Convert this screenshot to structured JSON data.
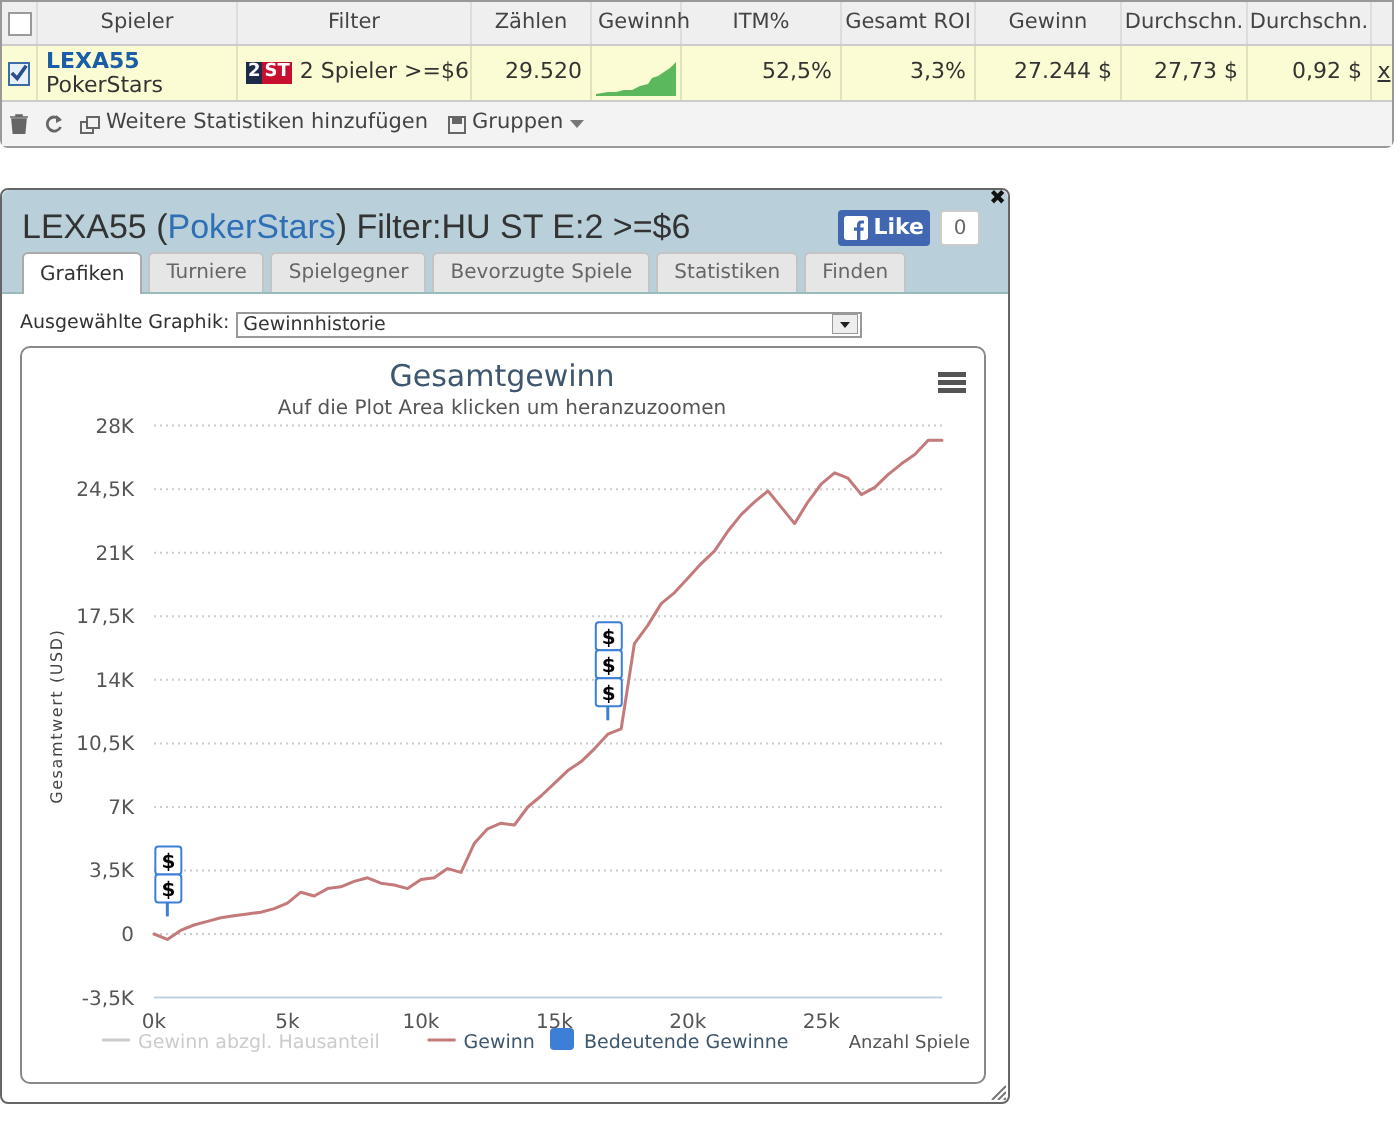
{
  "table": {
    "all_checked": false,
    "columns": [
      "Spieler",
      "Filter",
      "Zählen",
      "Gewinnh",
      "ITM%",
      "Gesamt ROI",
      "Gewinn",
      "Durchschn.",
      "Durchschn."
    ],
    "rows": [
      {
        "checked": true,
        "player": "LEXA55",
        "site": "PokerStars",
        "filter_badge": {
          "number": "2",
          "label": "ST"
        },
        "filter": "2 Spieler >=$6",
        "count": "29.520",
        "itm": "52,5%",
        "roi": "3,3%",
        "profit": "27.244 $",
        "avg_1": "27,73 $",
        "avg_2": "0,92 $",
        "remove": "x"
      }
    ]
  },
  "toolbar": {
    "add_stats": "Weitere Statistiken hinzufügen",
    "groups": "Gruppen"
  },
  "dialog": {
    "title_parts": [
      {
        "kind": "plain",
        "text": "LEXA55 ("
      },
      {
        "kind": "link",
        "text": "PokerStars"
      },
      {
        "kind": "plain",
        "text": ") Filter:HU ST E:2 >=$6"
      }
    ],
    "close": "✖",
    "like": {
      "label": "Like",
      "count": "0"
    },
    "tabs": [
      {
        "label": "Grafiken",
        "selected": true
      },
      {
        "label": "Turniere",
        "selected": false
      },
      {
        "label": "Spielgegner",
        "selected": false
      },
      {
        "label": "Bevorzugte Spiele",
        "selected": false
      },
      {
        "label": "Statistiken",
        "selected": false
      },
      {
        "label": "Finden",
        "selected": false
      }
    ],
    "graph_select": {
      "label": "Ausgewählte Graphik:",
      "value": "Gewinnhistorie"
    },
    "chart": {
      "chart_data": {
        "type": "line",
        "title": "Gesamtgewinn",
        "subtitle": "Auf die Plot Area klicken um heranzuzoomen",
        "xlabel": "Anzahl Spiele",
        "ylabel": "Gesamtwert (USD)",
        "x": [
          0,
          500,
          1000,
          1500,
          2000,
          2500,
          3000,
          3500,
          4000,
          4500,
          5000,
          5500,
          6000,
          6500,
          7000,
          7500,
          8000,
          8500,
          9000,
          9500,
          10000,
          10500,
          11000,
          11500,
          12000,
          12500,
          13000,
          13500,
          14000,
          14500,
          15000,
          15500,
          16000,
          16500,
          17000,
          17500,
          18000,
          18500,
          19000,
          19500,
          20000,
          20500,
          21000,
          21500,
          22000,
          22500,
          23000,
          23500,
          24000,
          24500,
          25000,
          25500,
          26000,
          26500,
          27000,
          27500,
          28000,
          28500,
          29000,
          29520
        ],
        "series": [
          {
            "name": "Gewinn",
            "color": "#c47a7a",
            "values": [
              0,
              -300,
              200,
              500,
              700,
              900,
              1000,
              1100,
              1200,
              1400,
              1700,
              2300,
              2100,
              2500,
              2600,
              2900,
              3100,
              2800,
              2700,
              2500,
              3000,
              3100,
              3600,
              3400,
              5000,
              5800,
              6100,
              6000,
              7000,
              7600,
              8300,
              9000,
              9500,
              10200,
              11000,
              11300,
              16000,
              17000,
              18200,
              18800,
              19600,
              20400,
              21100,
              22200,
              23100,
              23800,
              24400,
              23500,
              22600,
              23800,
              24800,
              25400,
              25100,
              24200,
              24600,
              25300,
              25900,
              26400,
              27200,
              27200
            ]
          }
        ],
        "xlim": [
          0,
          29520
        ],
        "ylim": [
          -3500,
          28000
        ],
        "xticks": [
          {
            "value": 0,
            "label": "0k"
          },
          {
            "value": 5000,
            "label": "5k"
          },
          {
            "value": 10000,
            "label": "10k"
          },
          {
            "value": 15000,
            "label": "15k"
          },
          {
            "value": 20000,
            "label": "20k"
          },
          {
            "value": 25000,
            "label": "25k"
          }
        ],
        "yticks": [
          {
            "value": -3500,
            "label": "-3,5K"
          },
          {
            "value": 0,
            "label": "0"
          },
          {
            "value": 3500,
            "label": "3,5K"
          },
          {
            "value": 7000,
            "label": "7K"
          },
          {
            "value": 10500,
            "label": "10,5K"
          },
          {
            "value": 14000,
            "label": "14K"
          },
          {
            "value": 17500,
            "label": "17,5K"
          },
          {
            "value": 21000,
            "label": "21K"
          },
          {
            "value": 24500,
            "label": "24,5K"
          },
          {
            "value": 28000,
            "label": "28K"
          }
        ],
        "grid": true
      },
      "flags": [
        {
          "labels": [
            "$",
            "$"
          ]
        },
        {
          "labels": [
            "$",
            "$",
            "$"
          ]
        }
      ],
      "legend": [
        {
          "kind": "line",
          "label": "Gewinn abzgl. Hausanteil",
          "hidden": true
        },
        {
          "kind": "series",
          "hidden": false
        },
        {
          "kind": "square",
          "label": "Bedeutende Gewinne",
          "hidden": false
        }
      ]
    }
  }
}
